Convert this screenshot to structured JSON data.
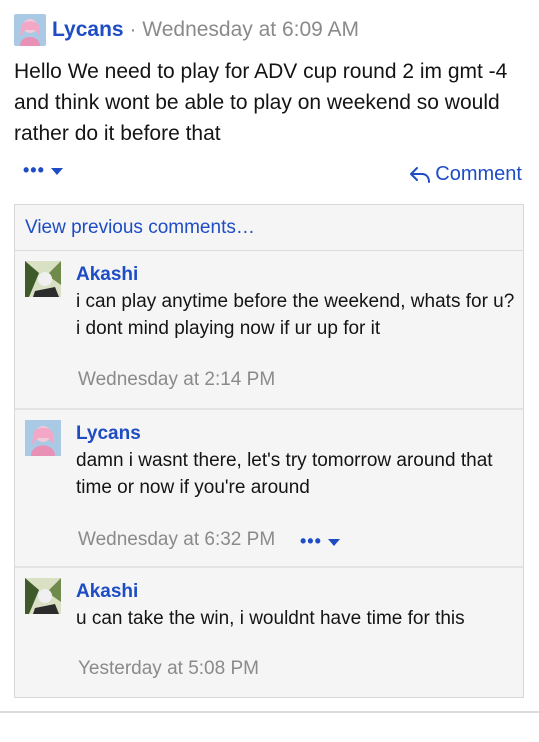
{
  "post": {
    "author": "Lycans",
    "separator": "·",
    "time": "Wednesday at 6:09 AM",
    "body": "Hello We need to play for ADV cup round 2 im gmt -4 and think wont be able to play on weekend so would rather do it before that",
    "more_icon": "more-dots-icon",
    "comment_label": "Comment"
  },
  "comments": {
    "view_previous": "View previous comments…",
    "items": [
      {
        "author": "Akashi",
        "text": "i can play anytime before the weekend, whats for u? i dont mind playing now if ur up for it",
        "time": "Wednesday at 2:14 PM"
      },
      {
        "author": "Lycans",
        "text": "damn i wasnt there, let's try tomorrow around that time or now if you're around",
        "time": "Wednesday at 6:32 PM"
      },
      {
        "author": "Akashi",
        "text": "u can take the win, i wouldnt have time for this",
        "time": "Yesterday at 5:08 PM"
      }
    ]
  },
  "colors": {
    "link": "#1d4cc4",
    "muted": "#8a8a8a",
    "panel": "#f5f5f5"
  }
}
